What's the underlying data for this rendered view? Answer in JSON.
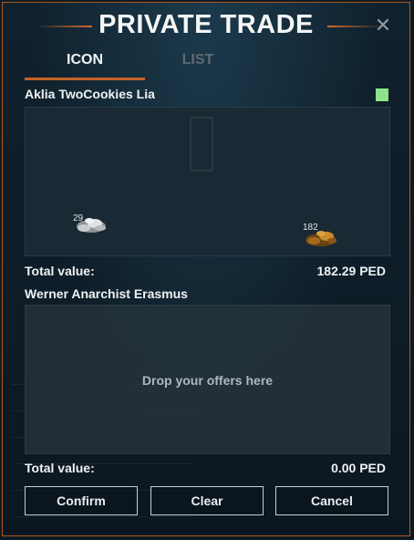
{
  "window": {
    "title": "PRIVATE TRADE",
    "close_icon": "close-icon"
  },
  "tabs": [
    {
      "label": "ICON",
      "active": true
    },
    {
      "label": "LIST",
      "active": false
    }
  ],
  "partner": {
    "name": "Aklia TwoCookies Lia",
    "ready_color": "#8ee38a",
    "items": [
      {
        "icon": "silver-ore-pile-icon",
        "quantity": "29"
      },
      {
        "icon": "gold-ore-pile-icon",
        "quantity": "182"
      }
    ],
    "total_label": "Total value:",
    "total_value": "182.29 PED"
  },
  "self": {
    "name": "Werner Anarchist Erasmus",
    "drop_hint": "Drop your offers here",
    "total_label": "Total value:",
    "total_value": "0.00 PED"
  },
  "buttons": {
    "confirm": "Confirm",
    "clear": "Clear",
    "cancel": "Cancel"
  },
  "colors": {
    "accent": "#d66a28",
    "border": "#b0581f"
  }
}
